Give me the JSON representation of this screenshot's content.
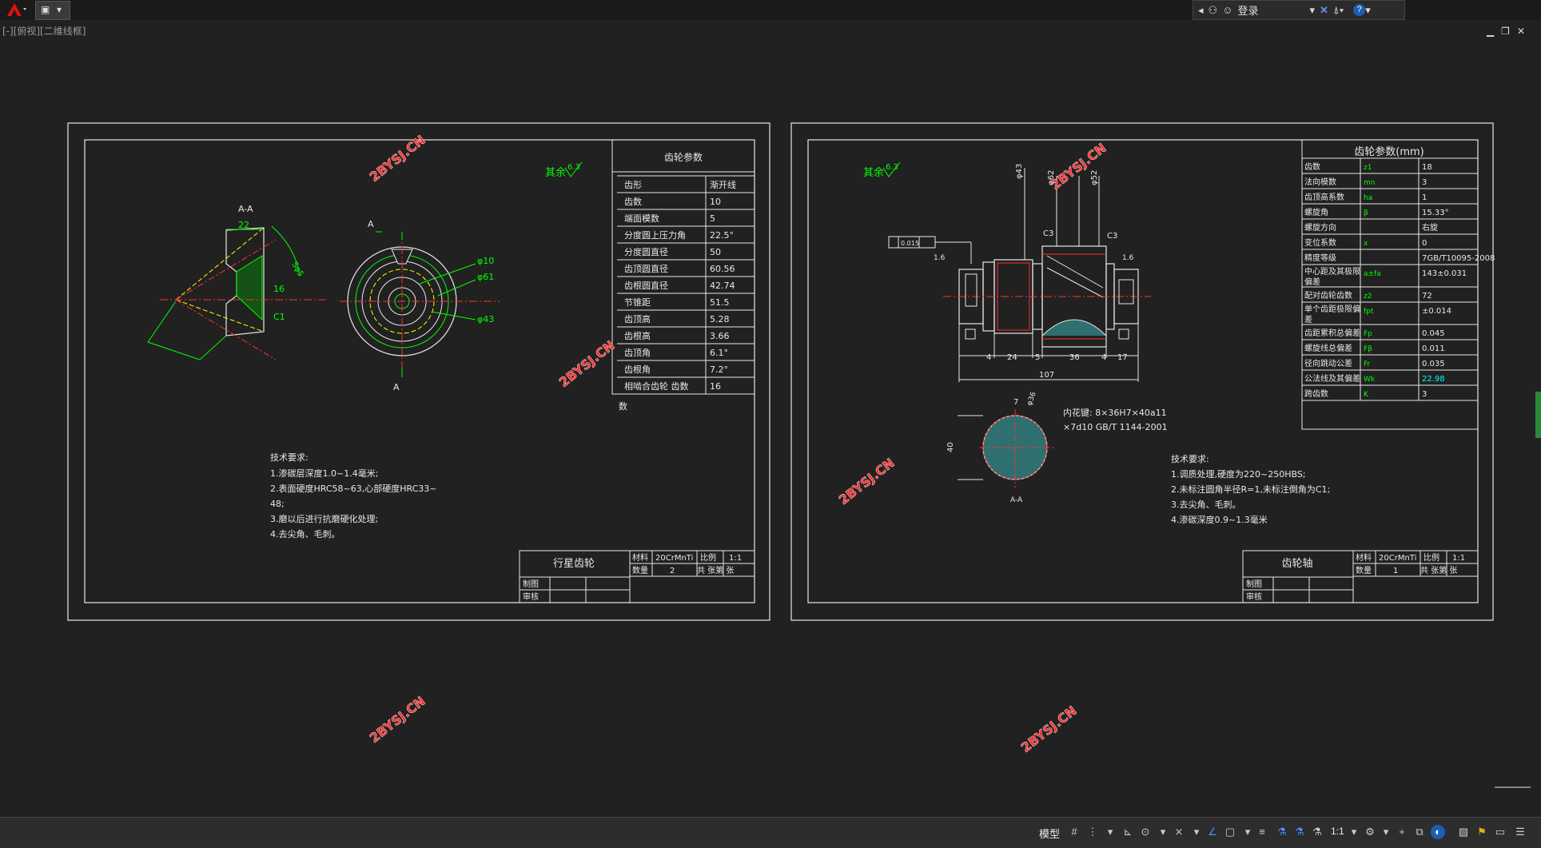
{
  "toolbar": {
    "signin_label": "登录",
    "help_label": "?"
  },
  "viewport": {
    "label": "[-][俯视][二维线框]"
  },
  "sheet1": {
    "title_block": {
      "part_name": "行星齿轮",
      "material_label": "材料",
      "material": "20CrMnTi",
      "scale_label": "比例",
      "scale": "1:1",
      "qty_label": "数量",
      "qty": "2",
      "sheets_label": "共 张第 张",
      "drawn_label": "制图",
      "checked_label": "审核"
    },
    "param_table": {
      "title": "齿轮参数",
      "rows": [
        [
          "齿形",
          "渐开线"
        ],
        [
          "齿数",
          "10"
        ],
        [
          "端面模数",
          "5"
        ],
        [
          "分度圆上压力角",
          "22.5°"
        ],
        [
          "分度圆直径",
          "50"
        ],
        [
          "齿顶圆直径",
          "60.56"
        ],
        [
          "齿根圆直径",
          "42.74"
        ],
        [
          "节锥距",
          "51.5"
        ],
        [
          "齿顶高",
          "5.28"
        ],
        [
          "齿根高",
          "3.66"
        ],
        [
          "齿顶角",
          "6.1°"
        ],
        [
          "齿根角",
          "7.2°"
        ],
        [
          "相啮合齿轮  齿数",
          "16"
        ]
      ],
      "overflow": "数"
    },
    "roughness": {
      "label": "其余",
      "value": "6.3"
    },
    "section_label": "A-A",
    "section_mark": "A",
    "dims": [
      "22",
      "16",
      "C1",
      "Sφ5"
    ],
    "front_dims": [
      "φ10",
      "φ61",
      "φ43"
    ],
    "tech_req": {
      "title": "技术要求:",
      "lines": [
        "1.渗碳层深度1.0~1.4毫米;",
        "2.表面硬度HRC58~63,心部硬度HRC33~",
        "48;",
        "3.磨以后进行抗磨硬化处理;",
        "4.去尖角、毛刺。"
      ]
    }
  },
  "sheet2": {
    "title_block": {
      "part_name": "齿轮轴",
      "material_label": "材料",
      "material": "20CrMnTi",
      "scale_label": "比例",
      "scale": "1:1",
      "qty_label": "数量",
      "qty": "1",
      "sheets_label": "共 张第 张",
      "drawn_label": "制图",
      "checked_label": "审核"
    },
    "param_table": {
      "title": "齿轮参数(mm)",
      "rows": [
        [
          "齿数",
          "z1",
          "18"
        ],
        [
          "法向模数",
          "mn",
          "3"
        ],
        [
          "齿顶高系数",
          "ha",
          "1"
        ],
        [
          "螺旋角",
          "β",
          "15.33°"
        ],
        [
          "螺旋方向",
          "",
          "右旋"
        ],
        [
          "变位系数",
          "x",
          "0"
        ],
        [
          "精度等级",
          "",
          "7GB/T10095-2008"
        ],
        [
          "中心距及其极限偏差",
          "a±fa",
          "143±0.031"
        ],
        [
          "配对齿轮齿数",
          "z2",
          "72"
        ],
        [
          "单个齿距极限偏差",
          "fpt",
          "±0.014"
        ],
        [
          "齿距累积总偏差",
          "Fp",
          "0.045"
        ],
        [
          "螺旋线总偏差",
          "Fβ",
          "0.011"
        ],
        [
          "径向跳动公差",
          "Fr",
          "0.035"
        ],
        [
          "公法线及其偏差",
          "Wk",
          "22.98"
        ],
        [
          "跨齿数",
          "K",
          "3"
        ]
      ]
    },
    "roughness": {
      "label": "其余",
      "value": "6.3"
    },
    "tolerance_frame": "0.015",
    "shaft_dims": [
      "4",
      "24",
      "5",
      "36",
      "4",
      "17",
      "107",
      "φ43",
      "φ62",
      "φ52",
      "C3",
      "C3",
      "1.6",
      "1.6"
    ],
    "section_label": "A-A",
    "section_dims": [
      "7",
      "φ36",
      "40"
    ],
    "spline_note": [
      "内花键: 8×36H7×40a11",
      "×7d10 GB/T 1144-2001"
    ],
    "tech_req": {
      "title": "技术要求:",
      "lines": [
        "1.调质处理,硬度为220~250HBS;",
        "2.未标注圆角半径R=1,未标注倒角为C1;",
        "3.去尖角、毛刺。",
        "4.渗碳深度0.9~1.3毫米"
      ]
    }
  },
  "watermarks": [
    "2BYSJ.CN",
    "2BYSJ.CN",
    "2BYSJ.CN",
    "2BYSJ.CN",
    "2BYSJ.CN",
    "2BYSJ.CN"
  ],
  "statusbar": {
    "model_label": "模型",
    "scale_label": "1:1"
  },
  "colors": {
    "background": "#212121",
    "green": "#00ff00",
    "red": "#ff0000",
    "white": "#ffffff",
    "watermark": "#ff2020",
    "yellow": "#ffff00",
    "cyan": "#00ffff"
  }
}
